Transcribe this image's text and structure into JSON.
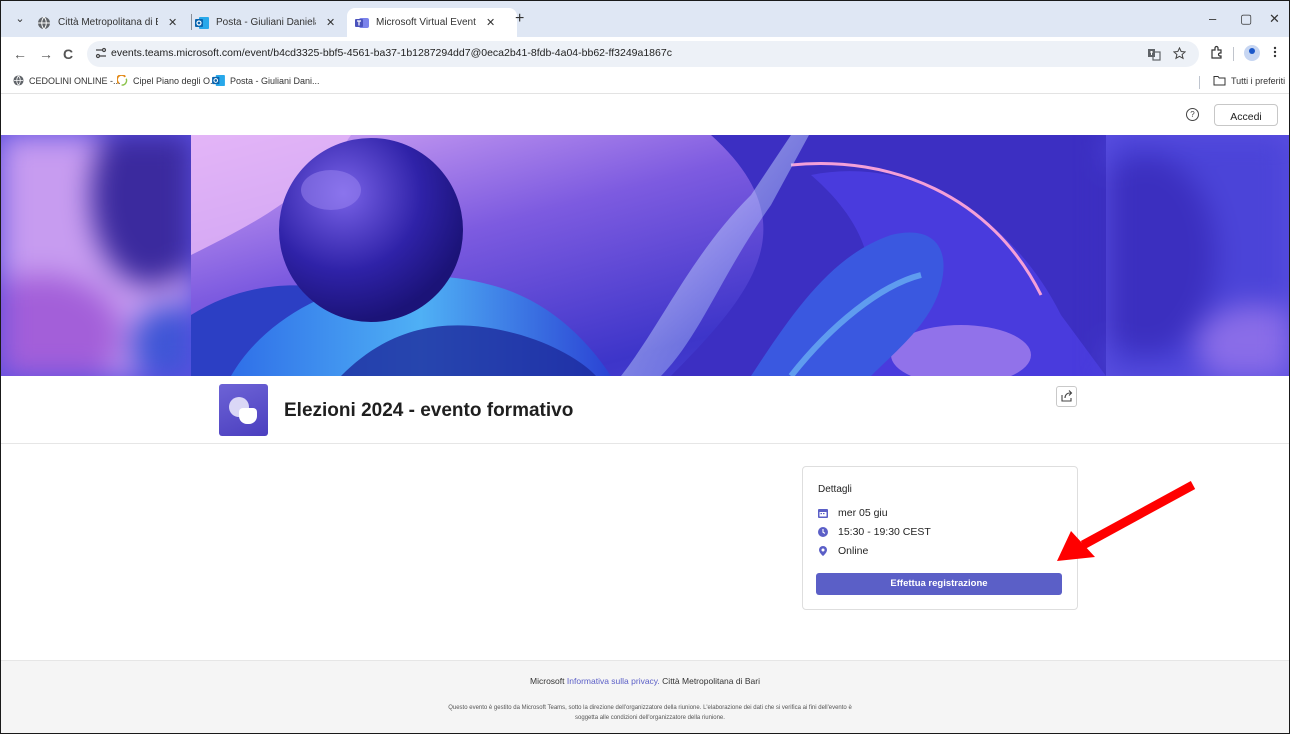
{
  "browser": {
    "tabs": [
      {
        "title": "Città Metropolitana di Bari - Sc",
        "active": false
      },
      {
        "title": "Posta - Giuliani Daniela - Outlo",
        "active": false
      },
      {
        "title": "Microsoft Virtual Events Power",
        "active": true
      }
    ],
    "close_glyph": "✕",
    "new_tab_glyph": "+",
    "tab_menu_glyph": "⌄",
    "window_controls": {
      "minimize": "–",
      "restore": "▢",
      "close": "✕"
    },
    "url": "events.teams.microsoft.com/event/b4cd3325-bbf5-4561-ba37-1b1287294dd7@0eca2b41-8fdb-4a04-bb62-ff3249a1867c",
    "nav": {
      "back": "←",
      "forward": "→",
      "reload": "C"
    },
    "bookmarks": [
      {
        "label": "CEDOLINI ONLINE -..."
      },
      {
        "label": "Cipel Piano degli O..."
      },
      {
        "label": "Posta - Giuliani Dani..."
      }
    ],
    "all_bookmarks": "Tutti i preferiti"
  },
  "header": {
    "help_glyph": "?",
    "signin_label": "Accedi"
  },
  "event": {
    "title": "Elezioni 2024 - evento formativo",
    "details": {
      "heading": "Dettagli",
      "date": "mer 05 giu",
      "time": "15:30 - 19:30 CEST",
      "location": "Online",
      "register_label": "Effettua registrazione"
    }
  },
  "footer": {
    "brand": "Microsoft",
    "privacy_link": "Informativa sulla privacy.",
    "organizer": "Città Metropolitana di Bari",
    "disclaimer": "Questo evento è gestito da Microsoft Teams, sotto la direzione dell'organizzatore della riunione. L'elaborazione dei dati che si verifica ai fini dell'evento è soggetta alle condizioni dell'organizzatore della riunione."
  },
  "colors": {
    "accent": "#5b5fc7",
    "annotation_arrow": "#ff0000",
    "tabstrip": "#dfe7f4"
  }
}
